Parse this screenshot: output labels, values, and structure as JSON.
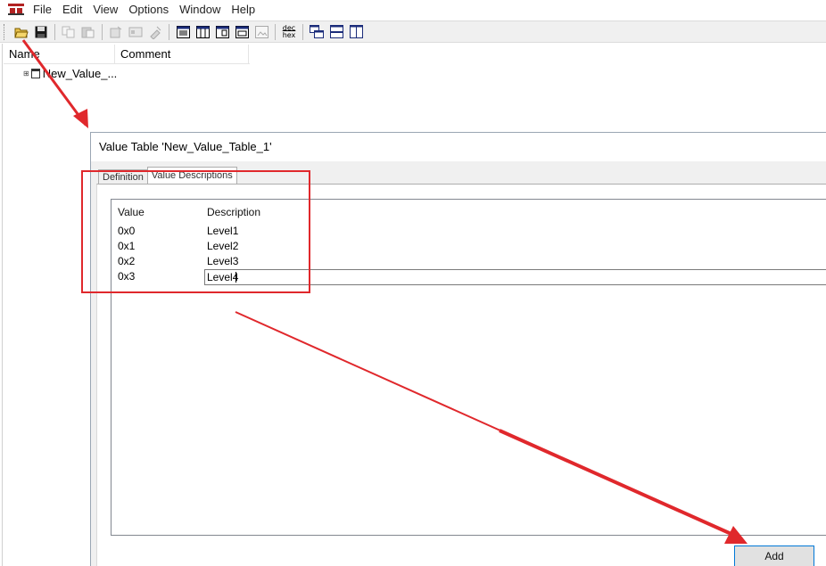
{
  "menubar": {
    "items": [
      "File",
      "Edit",
      "View",
      "Options",
      "Window",
      "Help"
    ]
  },
  "toolbar": {
    "buttons": [
      {
        "icon": "open-folder-icon",
        "enabled": true
      },
      {
        "icon": "save-icon",
        "enabled": true
      },
      {
        "icon": "copy-icon",
        "enabled": false
      },
      {
        "icon": "paste-icon",
        "enabled": false
      },
      {
        "icon": "new-object-icon",
        "enabled": false
      },
      {
        "icon": "properties-icon",
        "enabled": false
      },
      {
        "icon": "tool-icon",
        "enabled": false
      },
      {
        "icon": "list-view-icon",
        "enabled": true
      },
      {
        "icon": "table-view-icon",
        "enabled": true
      },
      {
        "icon": "detail-view-icon",
        "enabled": true
      },
      {
        "icon": "window-view-icon",
        "enabled": true
      },
      {
        "icon": "image-view-icon",
        "enabled": false
      },
      {
        "icon": "dec-hex-toggle-icon",
        "enabled": true,
        "label_top": "dec",
        "label_bottom": "hex"
      },
      {
        "icon": "cascade-windows-icon",
        "enabled": true
      },
      {
        "icon": "tile-horizontal-icon",
        "enabled": true
      },
      {
        "icon": "tile-vertical-icon",
        "enabled": true
      }
    ]
  },
  "list": {
    "columns": [
      "Name",
      "Comment"
    ],
    "tree_item": "New_Value_..."
  },
  "dialog": {
    "title": "Value Table 'New_Value_Table_1'",
    "tabs": [
      "Definition",
      "Value Descriptions"
    ],
    "active_tab": "Value Descriptions",
    "grid": {
      "headers": [
        "Value",
        "Description"
      ],
      "rows": [
        {
          "value": "0x0",
          "description": "Level1"
        },
        {
          "value": "0x1",
          "description": "Level2"
        },
        {
          "value": "0x2",
          "description": "Level3"
        },
        {
          "value": "0x3",
          "description": "Level4",
          "editing": true
        }
      ]
    },
    "add_label": "Add"
  },
  "colors": {
    "annotation_red": "#e0282c",
    "focus_blue": "#0078d7"
  }
}
